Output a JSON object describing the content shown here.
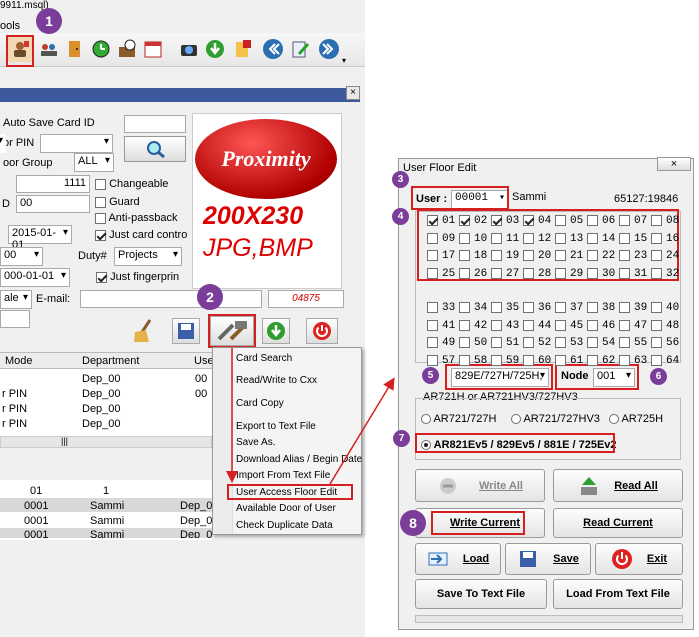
{
  "main_window": {
    "title_fragment": "9911.msql)",
    "menu_fragment": "ools",
    "fields": {
      "auto_save_card_id": "Auto Save Card ID",
      "or_pin": "or PIN",
      "door_group": "oor Group",
      "door_group_value": "ALL",
      "number_value": "1111",
      "label_d": "D",
      "zero_value": "00",
      "date1": "2015-01-01",
      "dash_value": "00",
      "duty_label": "Duty#",
      "duty_value": "Projects",
      "date2": "000-01-01",
      "gender_fragment": "ale",
      "email_label": "E-mail:",
      "card_code": "04875"
    },
    "checkboxes": [
      {
        "label": "Changeable",
        "checked": false
      },
      {
        "label": "Guard",
        "checked": false
      },
      {
        "label": "Anti-passback",
        "checked": false
      },
      {
        "label": "Just card contro",
        "checked": true
      },
      {
        "label": "Just fingerprin",
        "checked": true
      }
    ],
    "photo": {
      "logo_text": "Proximity",
      "size_text": "200X230",
      "format_text": "JPG,BMP"
    },
    "table_headers": [
      "Mode",
      "Department",
      "Use"
    ],
    "table_rows": [
      {
        "mode": "",
        "dept": "Dep_00",
        "use": "00"
      },
      {
        "mode": "r PIN",
        "dept": "Dep_00",
        "use": "00"
      },
      {
        "mode": "r PIN",
        "dept": "Dep_00",
        "use": ""
      },
      {
        "mode": "r PIN",
        "dept": "Dep_00",
        "use": ""
      }
    ],
    "grid_rows": [
      {
        "c1": "01",
        "c2": "1",
        "c3": "",
        "c4": ""
      },
      {
        "c1": "0001",
        "c2": "Sammi",
        "c3": "Dep_0",
        "c4": ""
      },
      {
        "c1": "0001",
        "c2": "Sammi",
        "c3": "Dep_0",
        "c4": ""
      },
      {
        "c1": "0001",
        "c2": "Sammi",
        "c3": "Dep_0",
        "c4": ""
      }
    ],
    "context_menu": [
      "Card Search",
      "Read/Write to Cxx",
      "Card Copy",
      "Export to Text File",
      "Save As.",
      "Download Alias / Begin Date",
      "Import From Text File",
      "User Access Floor Edit",
      "Available Door of User",
      "Check Duplicate Data"
    ]
  },
  "floor_dialog": {
    "title": "User Floor Edit",
    "user_label": "User :",
    "user_value": "00001",
    "user_name": "Sammi",
    "user_code": "65127:19846",
    "floors": [
      {
        "n": "01",
        "on": true
      },
      {
        "n": "02",
        "on": true
      },
      {
        "n": "03",
        "on": true
      },
      {
        "n": "04",
        "on": true
      },
      {
        "n": "05",
        "on": false
      },
      {
        "n": "06",
        "on": false
      },
      {
        "n": "07",
        "on": false
      },
      {
        "n": "08",
        "on": false
      },
      {
        "n": "09",
        "on": false
      },
      {
        "n": "10",
        "on": false
      },
      {
        "n": "11",
        "on": false
      },
      {
        "n": "12",
        "on": false
      },
      {
        "n": "13",
        "on": false
      },
      {
        "n": "14",
        "on": false
      },
      {
        "n": "15",
        "on": false
      },
      {
        "n": "16",
        "on": false
      },
      {
        "n": "17",
        "on": false
      },
      {
        "n": "18",
        "on": false
      },
      {
        "n": "19",
        "on": false
      },
      {
        "n": "20",
        "on": false
      },
      {
        "n": "21",
        "on": false
      },
      {
        "n": "22",
        "on": false
      },
      {
        "n": "23",
        "on": false
      },
      {
        "n": "24",
        "on": false
      },
      {
        "n": "25",
        "on": false
      },
      {
        "n": "26",
        "on": false
      },
      {
        "n": "27",
        "on": false
      },
      {
        "n": "28",
        "on": false
      },
      {
        "n": "29",
        "on": false
      },
      {
        "n": "30",
        "on": false
      },
      {
        "n": "31",
        "on": false
      },
      {
        "n": "32",
        "on": false
      },
      {
        "n": "33",
        "on": false
      },
      {
        "n": "34",
        "on": false
      },
      {
        "n": "35",
        "on": false
      },
      {
        "n": "36",
        "on": false
      },
      {
        "n": "37",
        "on": false
      },
      {
        "n": "38",
        "on": false
      },
      {
        "n": "39",
        "on": false
      },
      {
        "n": "40",
        "on": false
      },
      {
        "n": "41",
        "on": false
      },
      {
        "n": "42",
        "on": false
      },
      {
        "n": "43",
        "on": false
      },
      {
        "n": "44",
        "on": false
      },
      {
        "n": "45",
        "on": false
      },
      {
        "n": "46",
        "on": false
      },
      {
        "n": "47",
        "on": false
      },
      {
        "n": "48",
        "on": false
      },
      {
        "n": "49",
        "on": false
      },
      {
        "n": "50",
        "on": false
      },
      {
        "n": "51",
        "on": false
      },
      {
        "n": "52",
        "on": false
      },
      {
        "n": "53",
        "on": false
      },
      {
        "n": "54",
        "on": false
      },
      {
        "n": "55",
        "on": false
      },
      {
        "n": "56",
        "on": false
      },
      {
        "n": "57",
        "on": false
      },
      {
        "n": "58",
        "on": false
      },
      {
        "n": "59",
        "on": false
      },
      {
        "n": "60",
        "on": false
      },
      {
        "n": "61",
        "on": false
      },
      {
        "n": "62",
        "on": false
      },
      {
        "n": "63",
        "on": false
      },
      {
        "n": "64",
        "on": false
      }
    ],
    "model_value": "829E/727H/725H,",
    "node_label": "Node",
    "node_value": "001",
    "group_label": "AR721H or AR721HV3/727HV3",
    "radios": [
      {
        "label": "AR721/727H",
        "on": false
      },
      {
        "label": "AR721/727HV3",
        "on": false
      },
      {
        "label": "AR725H",
        "on": false
      },
      {
        "label": "AR821Ev5 / 829Ev5 / 881E / 725Ev2",
        "on": true
      }
    ],
    "buttons": {
      "write_all": "Write All",
      "read_all": "Read All",
      "write_current": "Write Current",
      "read_current": "Read Current",
      "load": "Load",
      "save": "Save",
      "exit": "Exit",
      "save_to_text": "Save To Text File",
      "load_from_text": "Load From Text File"
    }
  },
  "badges": [
    "1",
    "2",
    "3",
    "4",
    "5",
    "6",
    "7",
    "8"
  ],
  "colors": {
    "badge": "#7a3e9a",
    "highlight": "#d42020",
    "arrow": "#d42020"
  }
}
